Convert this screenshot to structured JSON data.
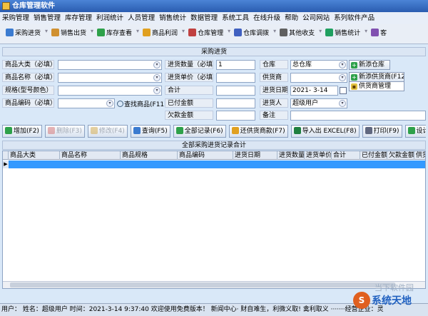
{
  "window": {
    "title": "仓库管理软件"
  },
  "menu": [
    "采购管理",
    "销售管理",
    "库存管理",
    "利润统计",
    "人员管理",
    "销售统计",
    "数据管理",
    "系统工具",
    "在线升级",
    "帮助",
    "公司网站",
    "系列软件产品"
  ],
  "toolbar": [
    {
      "label": "采购进货",
      "icon": "cart-icon",
      "color": "#3b7bd0"
    },
    {
      "label": "销售出货",
      "icon": "box-out-icon",
      "color": "#d09030"
    },
    {
      "label": "库存查看",
      "icon": "warehouse-icon",
      "color": "#2ea14a"
    },
    {
      "label": "商品利润",
      "icon": "money-icon",
      "color": "#e0a020"
    },
    {
      "label": "仓库管理",
      "icon": "building-icon",
      "color": "#c04040"
    },
    {
      "label": "仓库调拨",
      "icon": "transfer-icon",
      "color": "#4060c0"
    },
    {
      "label": "其他收支",
      "icon": "ledger-icon",
      "color": "#606060"
    },
    {
      "label": "销售统计",
      "icon": "chart-icon",
      "color": "#20a060"
    },
    {
      "label": "客",
      "icon": "customer-icon",
      "color": "#8050b0"
    }
  ],
  "section_title": "采购进货",
  "form": {
    "category_label": "商品大类（必填）",
    "name_label": "商品名称（必填）",
    "spec_label": "规格(型号颜色）",
    "code_label": "商品编码（必填）",
    "find_goods": "查找商品(F11)",
    "qty_label": "进货数量（必填）",
    "qty_value": "1",
    "price_label": "进货单价（必填）",
    "total_label": "合计",
    "paid_label": "已付金额",
    "owed_label": "欠款金额",
    "warehouse_label": "仓库",
    "warehouse_value": "总仓库",
    "supplier_label": "供货商",
    "date_label": "进货日期",
    "date_value": "2021- 3-14",
    "buyer_label": "进货人",
    "buyer_value": "超级用户",
    "remark_label": "备注",
    "add_warehouse": "新添仓库",
    "add_supplier": "新添供货商(F12)",
    "supplier_mgmt": "供货商管理"
  },
  "actions": [
    {
      "label": "增加(F2)",
      "enabled": true,
      "icon": "add-icon",
      "color": "#2ea14a"
    },
    {
      "label": "删除(F3)",
      "enabled": false,
      "icon": "delete-icon",
      "color": "#d06060"
    },
    {
      "label": "修改(F4)",
      "enabled": false,
      "icon": "edit-icon",
      "color": "#d0a030"
    },
    {
      "label": "查询(F5)",
      "enabled": true,
      "icon": "query-icon",
      "color": "#3b7bd0"
    },
    {
      "label": "全部记录(F6)",
      "enabled": true,
      "icon": "check-icon",
      "color": "#2ea14a"
    },
    {
      "label": "还供货商款(F7)",
      "enabled": true,
      "icon": "refund-icon",
      "color": "#e0a020"
    },
    {
      "label": "导入出 EXCEL(F8)",
      "enabled": true,
      "icon": "excel-icon",
      "color": "#208040"
    },
    {
      "label": "打印(F9)",
      "enabled": true,
      "icon": "print-icon",
      "color": "#606880"
    },
    {
      "label": "设计报表",
      "enabled": true,
      "icon": "design-icon",
      "color": "#2ea14a"
    }
  ],
  "records_title": "全部采购进货记录合计",
  "table": {
    "columns": [
      "商品大类",
      "商品名称",
      "商品规格",
      "商品编码",
      "进货日期",
      "进货数量",
      "进货单价",
      "合计",
      "已付金额",
      "欠款金额",
      "供货商"
    ],
    "row_indicator": "▶"
  },
  "status": "用户：  姓名：超级用户   时间：2021-3-14 9:37:40 欢迎使用免费版本！   新闻中心· 财自难生，利微义取! 禽利取义 ·······经营企业：灵",
  "watermark": {
    "top": "当下软件园",
    "brand": "系统天地",
    "logo": "S"
  }
}
